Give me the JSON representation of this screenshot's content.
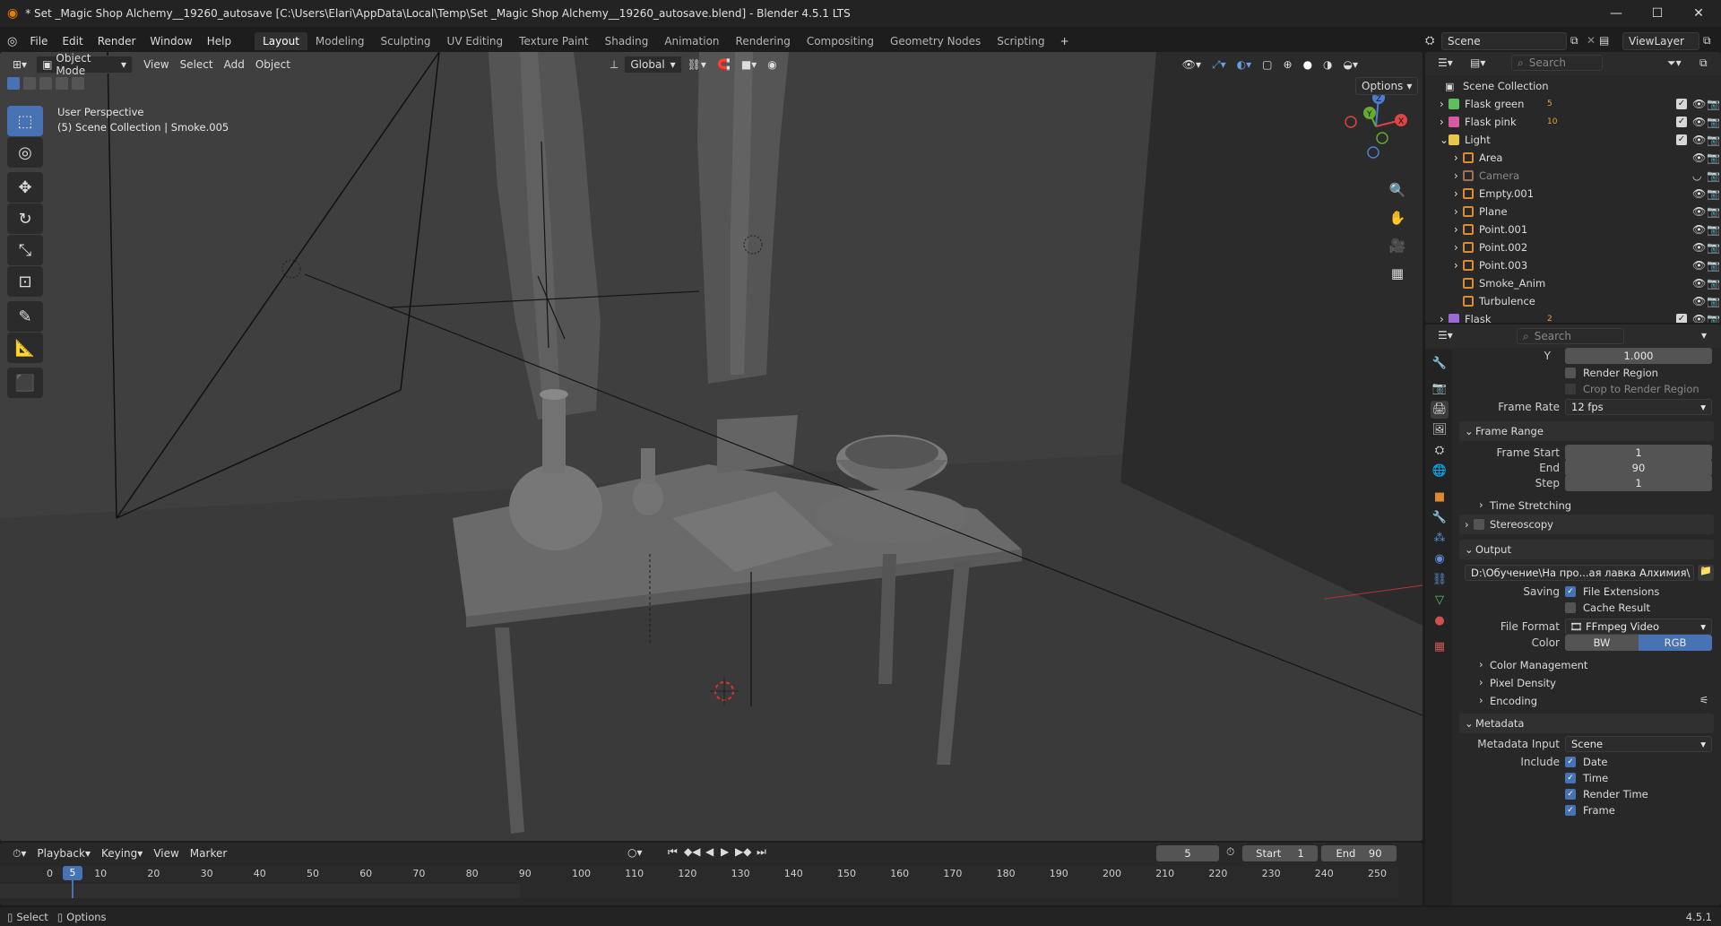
{
  "title_bar": {
    "title": "* Set _Magic Shop Alchemy__19260_autosave [C:\\Users\\Elari\\AppData\\Local\\Temp\\Set _Magic Shop Alchemy__19260_autosave.blend] - Blender 4.5.1 LTS",
    "minimize": "—",
    "maximize": "☐",
    "close": "✕"
  },
  "menu": [
    "File",
    "Edit",
    "Render",
    "Window",
    "Help"
  ],
  "workspaces": [
    "Layout",
    "Modeling",
    "Sculpting",
    "UV Editing",
    "Texture Paint",
    "Shading",
    "Animation",
    "Rendering",
    "Compositing",
    "Geometry Nodes",
    "Scripting"
  ],
  "workspace_add": "+",
  "scene": {
    "name": "Scene",
    "view_layer": "ViewLayer"
  },
  "viewport": {
    "mode": "Object Mode",
    "menus": [
      "View",
      "Select",
      "Add",
      "Object"
    ],
    "transform_orientation": "Global",
    "options_label": "Options",
    "info_line1": "User Perspective",
    "info_line2": "(5) Scene Collection | Smoke.005",
    "gizmo": {
      "x": "X",
      "y": "Y",
      "z": "Z"
    }
  },
  "outliner": {
    "search_placeholder": "Search",
    "root": "Scene Collection",
    "rows": [
      {
        "label": "Flask green",
        "badge": "5"
      },
      {
        "label": "Flask pink",
        "badge": "10"
      },
      {
        "label": "Light",
        "badge": ""
      },
      {
        "label": "Area",
        "badge": ""
      },
      {
        "label": "Camera",
        "badge": ""
      },
      {
        "label": "Empty.001",
        "badge": ""
      },
      {
        "label": "Plane",
        "badge": ""
      },
      {
        "label": "Point.001",
        "badge": ""
      },
      {
        "label": "Point.002",
        "badge": ""
      },
      {
        "label": "Point.003",
        "badge": ""
      },
      {
        "label": "Smoke_Anim",
        "badge": ""
      },
      {
        "label": "Turbulence",
        "badge": ""
      },
      {
        "label": "Flask",
        "badge": "2"
      }
    ]
  },
  "properties": {
    "search_placeholder": "Search",
    "aspect_y_label": "Y",
    "aspect_y_value": "1.000",
    "render_region": "Render Region",
    "crop_region": "Crop to Render Region",
    "frame_rate_label": "Frame Rate",
    "frame_rate_value": "12 fps",
    "frame_range": {
      "title": "Frame Range",
      "start_label": "Frame Start",
      "start": "1",
      "end_label": "End",
      "end": "90",
      "step_label": "Step",
      "step": "1"
    },
    "time_stretching": "Time Stretching",
    "stereoscopy": "Stereoscopy",
    "output": {
      "title": "Output",
      "path": "D:\\Обучение\\На про...ая лавка  Алхимия\\",
      "saving_label": "Saving",
      "file_extensions": "File Extensions",
      "cache_result": "Cache Result",
      "file_format_label": "File Format",
      "file_format": "FFmpeg Video",
      "color_label": "Color",
      "color_bw": "BW",
      "color_rgb": "RGB"
    },
    "color_management": "Color Management",
    "pixel_density": "Pixel Density",
    "encoding": "Encoding",
    "metadata": {
      "title": "Metadata",
      "input_label": "Metadata Input",
      "input_value": "Scene",
      "include_label": "Include",
      "items": [
        "Date",
        "Time",
        "Render Time",
        "Frame"
      ]
    }
  },
  "timeline": {
    "menus": [
      "Playback",
      "Keying",
      "View",
      "Marker"
    ],
    "current_frame": "5",
    "start_label": "Start",
    "start": "1",
    "end_label": "End",
    "end": "90",
    "ruler": [
      "0",
      "10",
      "20",
      "30",
      "40",
      "50",
      "60",
      "70",
      "80",
      "90",
      "100",
      "110",
      "120",
      "130",
      "140",
      "150",
      "160",
      "170",
      "180",
      "190",
      "200",
      "210",
      "220",
      "230",
      "240",
      "250"
    ],
    "playhead": "5"
  },
  "status_bar": {
    "select": "Select",
    "options": "Options",
    "version": "4.5.1"
  }
}
